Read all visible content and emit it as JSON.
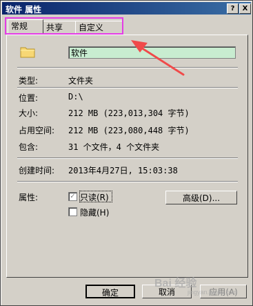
{
  "window": {
    "title": "软件 属性",
    "help_btn": "?",
    "close_btn": "X"
  },
  "tabs": [
    {
      "label": "常规"
    },
    {
      "label": "共享"
    },
    {
      "label": "自定义"
    }
  ],
  "general": {
    "name_value": "软件",
    "rows": {
      "type_label": "类型:",
      "type_value": "文件夹",
      "location_label": "位置:",
      "location_value": "D:\\",
      "size_label": "大小:",
      "size_value": "212 MB (223,013,304 字节)",
      "disk_label": "占用空间:",
      "disk_value": "212 MB (223,080,448 字节)",
      "contains_label": "包含:",
      "contains_value": "31 个文件，4 个文件夹",
      "created_label": "创建时间:",
      "created_value": "2013年4月27日, 15:03:38",
      "attributes_label": "属性:"
    },
    "attributes": {
      "readonly_label": "只读(R)",
      "readonly_mark": "✓",
      "hidden_label": "隐藏(H)",
      "advanced_button": "高级(D)..."
    }
  },
  "buttons": {
    "ok": "确定",
    "cancel": "取消",
    "apply": "应用(A)"
  },
  "annotation": {
    "highlight_color": "#e43ce6",
    "arrow_color": "#f04a4a"
  },
  "watermark": {
    "text": "Bai 经验",
    "sub": "jingyan.baidu.com"
  }
}
